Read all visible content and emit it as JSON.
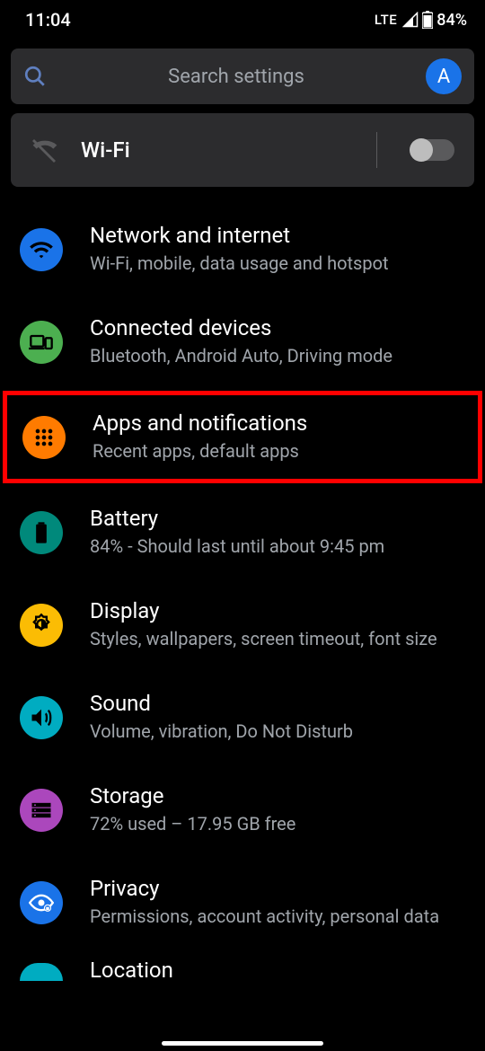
{
  "status": {
    "time": "11:04",
    "network": "LTE",
    "battery": "84%"
  },
  "search": {
    "placeholder": "Search settings",
    "avatar_letter": "A"
  },
  "wifi_tile": {
    "label": "Wi-Fi",
    "enabled": false
  },
  "items": [
    {
      "title": "Network and internet",
      "subtitle": "Wi-Fi, mobile, data usage and hotspot",
      "icon": "wifi-icon",
      "color": "blue",
      "highlighted": false
    },
    {
      "title": "Connected devices",
      "subtitle": "Bluetooth, Android Auto, Driving mode",
      "icon": "devices-icon",
      "color": "green",
      "highlighted": false
    },
    {
      "title": "Apps and notifications",
      "subtitle": "Recent apps, default apps",
      "icon": "apps-icon",
      "color": "orange",
      "highlighted": true
    },
    {
      "title": "Battery",
      "subtitle": "84% - Should last until about 9:45 pm",
      "icon": "battery-icon",
      "color": "teal",
      "highlighted": false
    },
    {
      "title": "Display",
      "subtitle": "Styles, wallpapers, screen timeout, font size",
      "icon": "brightness-icon",
      "color": "yellow",
      "highlighted": false
    },
    {
      "title": "Sound",
      "subtitle": "Volume, vibration, Do Not Disturb",
      "icon": "volume-icon",
      "color": "cyan",
      "highlighted": false
    },
    {
      "title": "Storage",
      "subtitle": "72% used – 17.95 GB free",
      "icon": "storage-icon",
      "color": "purple",
      "highlighted": false
    },
    {
      "title": "Privacy",
      "subtitle": "Permissions, account activity, personal data",
      "icon": "privacy-icon",
      "color": "blue",
      "highlighted": false
    }
  ],
  "partial_item": {
    "title": "Location"
  }
}
